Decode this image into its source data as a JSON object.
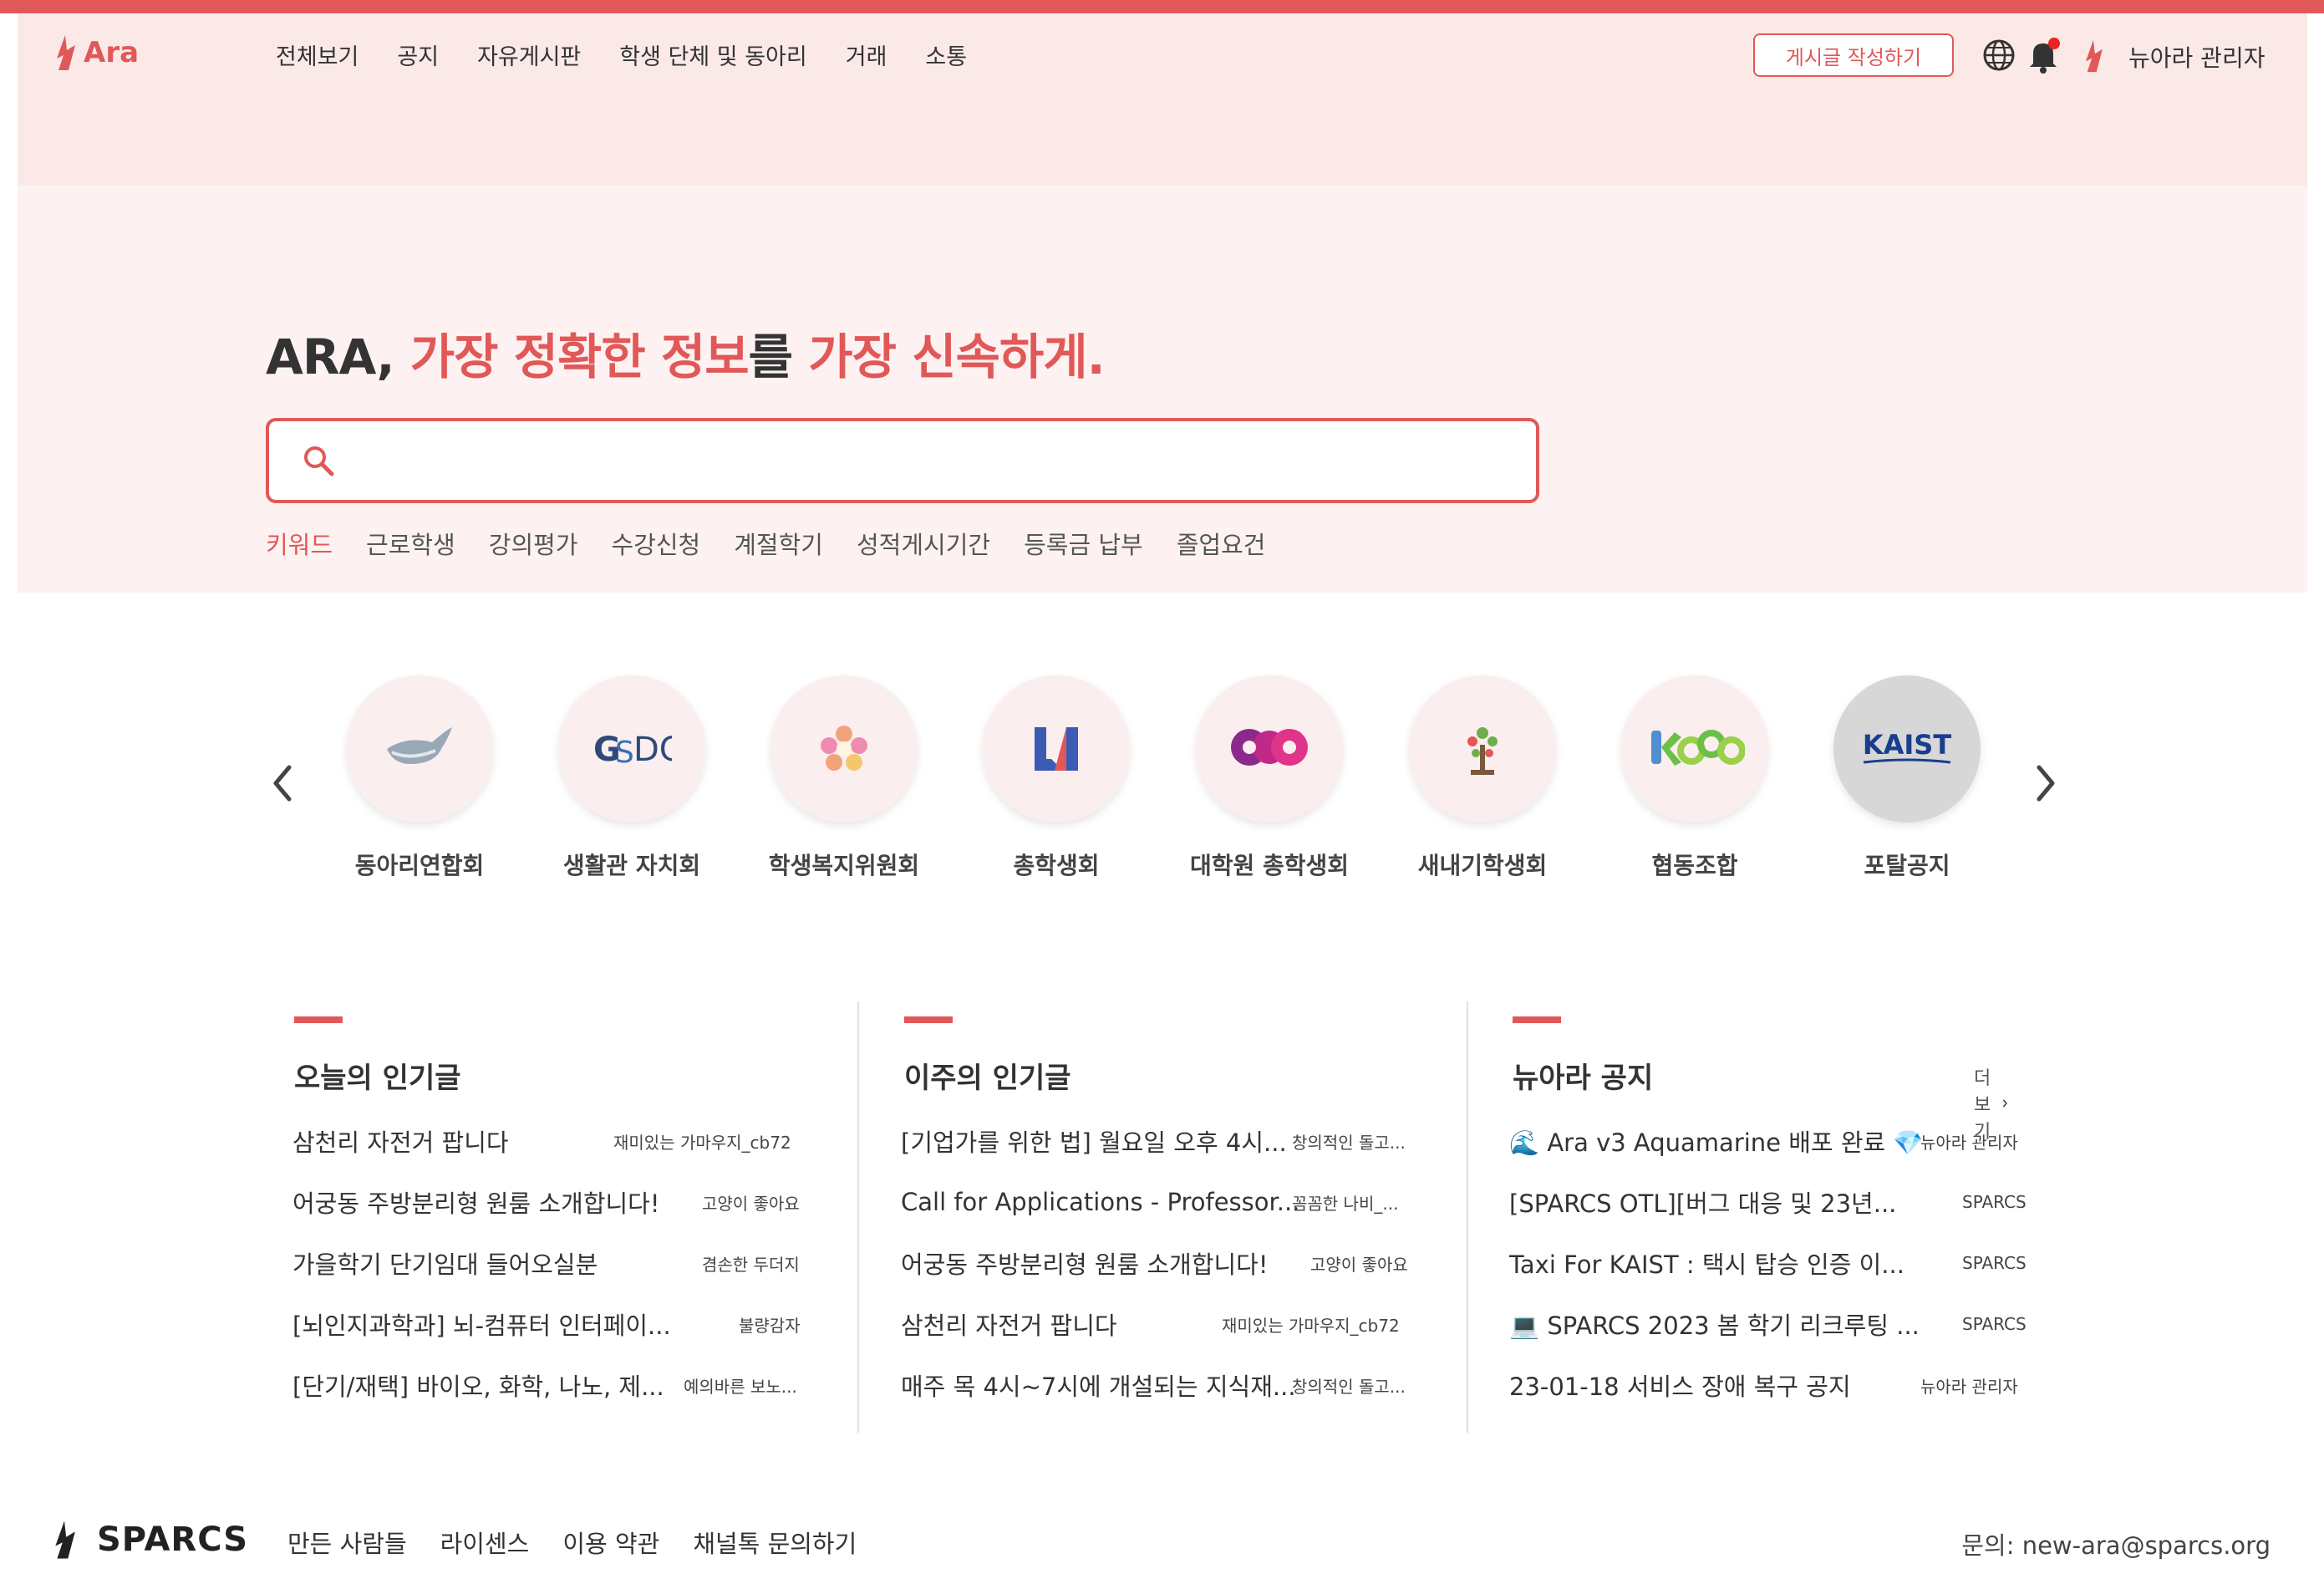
{
  "header": {
    "logo_text": "Ara",
    "nav": [
      "전체보기",
      "공지",
      "자유게시판",
      "학생 단체 및 동아리",
      "거래",
      "소통"
    ],
    "write_button": "게시글 작성하기",
    "user_name": "뉴아라 관리자"
  },
  "hero": {
    "slogan_parts": [
      "ARA, ",
      "가장 정확한 정보",
      "를 ",
      "가장 신속하게."
    ],
    "search_placeholder": "",
    "keywords_title": "키워드",
    "keywords": [
      "근로학생",
      "강의평가",
      "수강신청",
      "계절학기",
      "성적게시기간",
      "등록금 납부",
      "졸업요건"
    ]
  },
  "boards": [
    {
      "label": "동아리연합회",
      "icon": "whale-icon"
    },
    {
      "label": "생활관 자치회",
      "icon": "gsdc-logo"
    },
    {
      "label": "학생복지위원회",
      "icon": "flower-icon"
    },
    {
      "label": "총학생회",
      "icon": "ua-logo"
    },
    {
      "label": "대학원 총학생회",
      "icon": "gsa-logo"
    },
    {
      "label": "새내기학생회",
      "icon": "tree-icon"
    },
    {
      "label": "협동조합",
      "icon": "coop-logo"
    },
    {
      "label": "포탈공지",
      "icon": "kaist-logo",
      "logo_text": "KAIST"
    }
  ],
  "lists": {
    "today": {
      "title": "오늘의 인기글",
      "items": [
        {
          "title": "삼천리 자전거 팝니다",
          "author": "재미있는 가마우지_cb72"
        },
        {
          "title": "어궁동 주방분리형 원룸 소개합니다!",
          "author": "고양이 좋아요"
        },
        {
          "title": "가을학기 단기임대 들어오실분",
          "author": "겸손한 두더지"
        },
        {
          "title": "[뇌인지과학과] 뇌-컴퓨터 인터페이...",
          "author": "불량감자"
        },
        {
          "title": "[단기/재택] 바이오, 화학, 나노, 제...",
          "author": "예의바른 보노..."
        }
      ]
    },
    "week": {
      "title": "이주의 인기글",
      "items": [
        {
          "title": "[기업가를 위한 법] 월요일 오후 4시...",
          "author": "창의적인 돌고..."
        },
        {
          "title": "Call for Applications - Professor...",
          "author": "꼼꼼한 나비_..."
        },
        {
          "title": "어궁동 주방분리형 원룸 소개합니다!",
          "author": "고양이 좋아요"
        },
        {
          "title": "삼천리 자전거 팝니다",
          "author": "재미있는 가마우지_cb72"
        },
        {
          "title": "매주 목 4시~7시에 개설되는 지식재...",
          "author": "창의적인 돌고..."
        }
      ]
    },
    "notice": {
      "title": "뉴아라 공지",
      "more": "더보기",
      "items": [
        {
          "title": "🌊 Ara v3 Aquamarine 배포 완료 💎",
          "author": "뉴아라 관리자"
        },
        {
          "title": "[SPARCS OTL][버그 대응 및 23년...",
          "author": "SPARCS"
        },
        {
          "title": "Taxi For KAIST : 택시 탑승 인증 이...",
          "author": "SPARCS"
        },
        {
          "title": "💻 SPARCS 2023 봄 학기 리크루팅 ...",
          "author": "SPARCS"
        },
        {
          "title": "23-01-18 서비스 장애 복구 공지",
          "author": "뉴아라 관리자"
        }
      ]
    }
  },
  "footer": {
    "logo_text": "SPARCS",
    "links": [
      "만든 사람들",
      "라이센스",
      "이용 약관",
      "채널톡 문의하기"
    ],
    "contact": "문의: new-ara@sparcs.org"
  },
  "colors": {
    "accent": "#e15858",
    "hero_bg": "#fdf2f1",
    "nav_bg": "#fbe9e8"
  }
}
